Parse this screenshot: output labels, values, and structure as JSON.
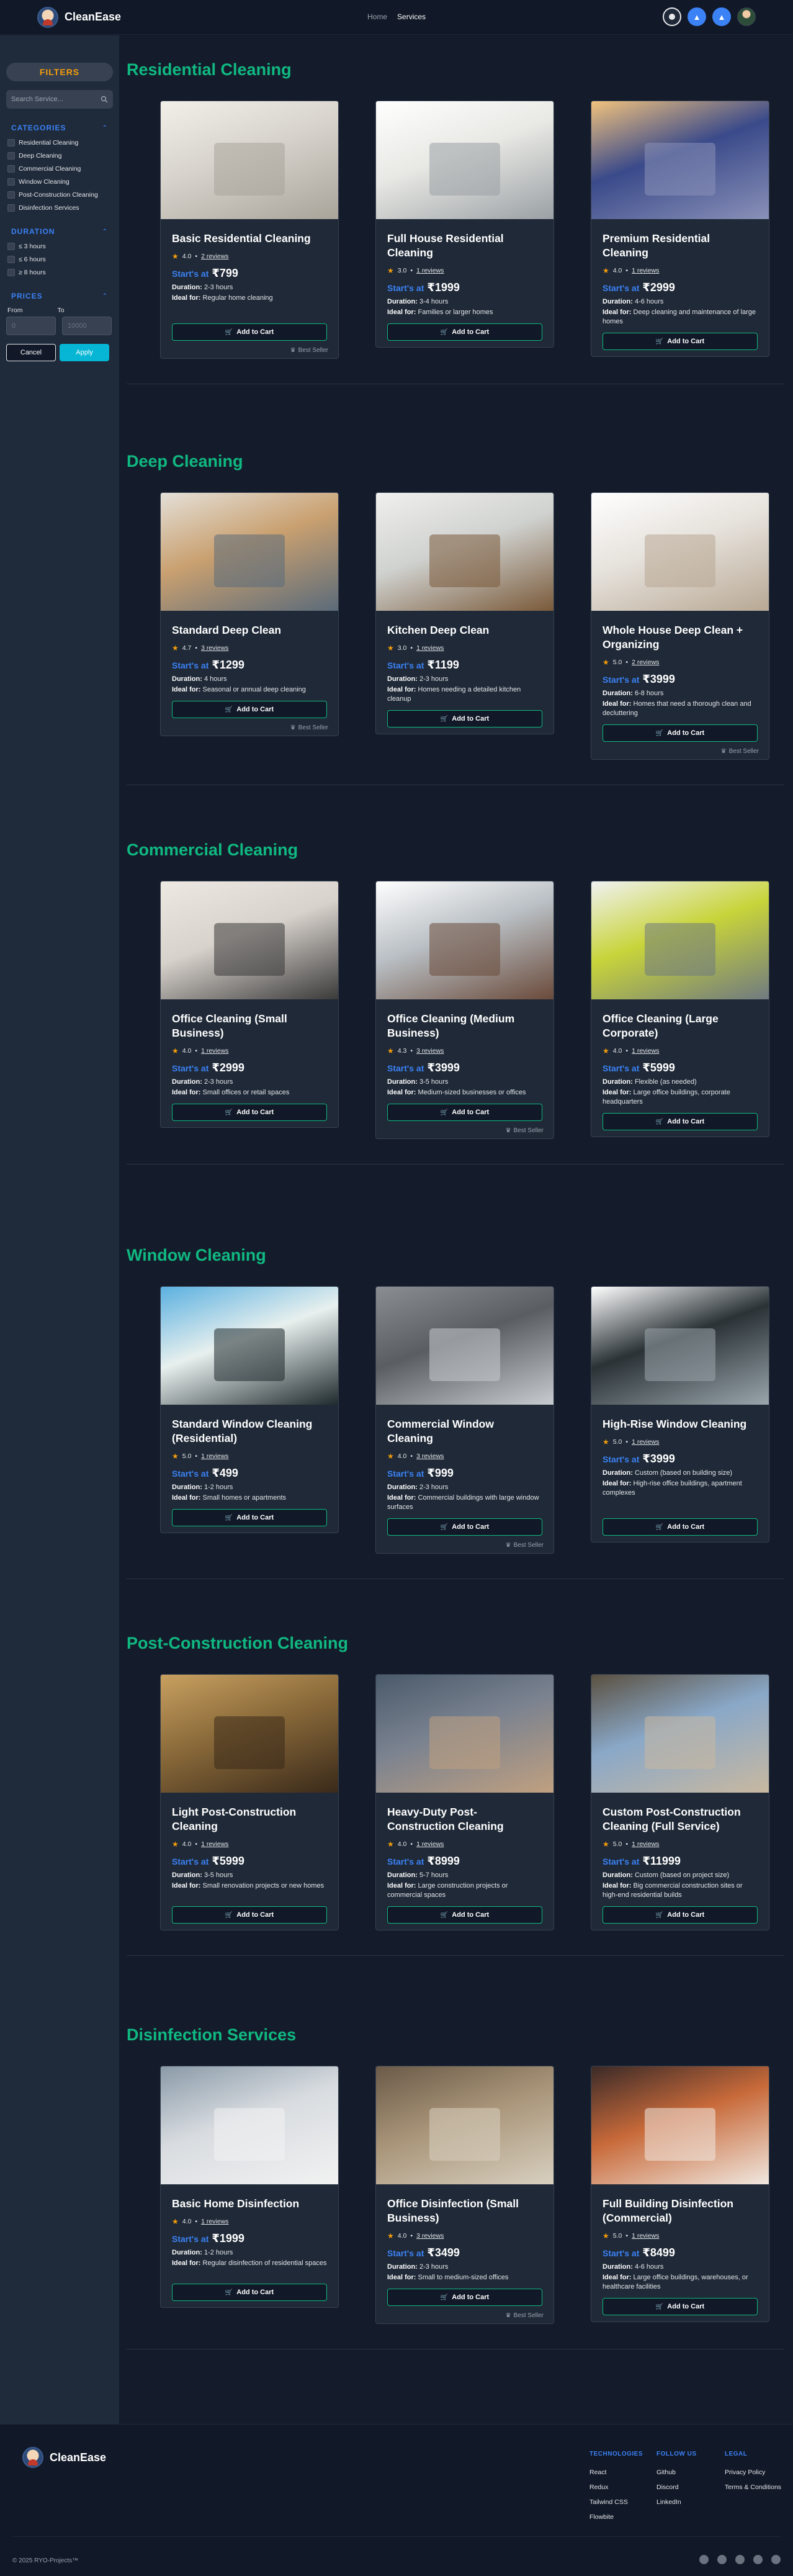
{
  "header": {
    "brand": "CleanEase",
    "nav": [
      {
        "label": "Home"
      },
      {
        "label": "Services"
      }
    ]
  },
  "sidebar": {
    "title": "FILTERS",
    "search_placeholder": "Search Service...",
    "categories": {
      "title": "CATEGORIES",
      "items": [
        "Residential Cleaning",
        "Deep Cleaning",
        "Commercial Cleaning",
        "Window Cleaning",
        "Post-Construction Cleaning",
        "Disinfection Services"
      ]
    },
    "duration": {
      "title": "DURATION",
      "items": [
        "≤ 3 hours",
        "≤ 6 hours",
        "≥ 8 hours"
      ]
    },
    "prices": {
      "title": "PRICES",
      "from_label": "From",
      "to_label": "To",
      "from_placeholder": "0",
      "to_placeholder": "10000"
    },
    "cancel_label": "Cancel",
    "apply_label": "Apply"
  },
  "common": {
    "starts_at": "Start's at",
    "duration_label": "Duration:",
    "ideal_label": "Ideal for:",
    "add_to_cart": "Add to Cart",
    "best_seller": "Best Seller"
  },
  "sections": [
    {
      "title": "Residential Cleaning",
      "cards": [
        {
          "name": "Basic Residential Cleaning",
          "rating": "4.0",
          "reviews": "2 reviews",
          "price": "₹799",
          "duration": "2-3 hours",
          "ideal": "Regular home cleaning",
          "best_seller": true
        },
        {
          "name": "Full House Residential Cleaning",
          "rating": "3.0",
          "reviews": "1 reviews",
          "price": "₹1999",
          "duration": "3-4 hours",
          "ideal": "Families or larger homes",
          "best_seller": false
        },
        {
          "name": "Premium Residential Cleaning",
          "rating": "4.0",
          "reviews": "1 reviews",
          "price": "₹2999",
          "duration": "4-6 hours",
          "ideal": "Deep cleaning and maintenance of large homes",
          "best_seller": false
        }
      ]
    },
    {
      "title": "Deep Cleaning",
      "cards": [
        {
          "name": "Standard Deep Clean",
          "rating": "4.7",
          "reviews": "3 reviews",
          "price": "₹1299",
          "duration": "4 hours",
          "ideal": "Seasonal or annual deep cleaning",
          "best_seller": true
        },
        {
          "name": "Kitchen Deep Clean",
          "rating": "3.0",
          "reviews": "1 reviews",
          "price": "₹1199",
          "duration": "2-3 hours",
          "ideal": "Homes needing a detailed kitchen cleanup",
          "best_seller": false
        },
        {
          "name": "Whole House Deep Clean + Organizing",
          "rating": "5.0",
          "reviews": "2 reviews",
          "price": "₹3999",
          "duration": "6-8 hours",
          "ideal": "Homes that need a thorough clean and decluttering",
          "best_seller": true
        }
      ]
    },
    {
      "title": "Commercial Cleaning",
      "cards": [
        {
          "name": "Office Cleaning (Small Business)",
          "rating": "4.0",
          "reviews": "1 reviews",
          "price": "₹2999",
          "duration": "2-3 hours",
          "ideal": "Small offices or retail spaces",
          "best_seller": false
        },
        {
          "name": "Office Cleaning (Medium Business)",
          "rating": "4.3",
          "reviews": "3 reviews",
          "price": "₹3999",
          "duration": "3-5 hours",
          "ideal": "Medium-sized businesses or offices",
          "best_seller": true
        },
        {
          "name": "Office Cleaning (Large Corporate)",
          "rating": "4.0",
          "reviews": "1 reviews",
          "price": "₹5999",
          "duration": "Flexible (as needed)",
          "ideal": "Large office buildings, corporate headquarters",
          "best_seller": false
        }
      ]
    },
    {
      "title": "Window Cleaning",
      "cards": [
        {
          "name": "Standard Window Cleaning (Residential)",
          "rating": "5.0",
          "reviews": "1 reviews",
          "price": "₹499",
          "duration": "1-2 hours",
          "ideal": "Small homes or apartments",
          "best_seller": false
        },
        {
          "name": "Commercial Window Cleaning",
          "rating": "4.0",
          "reviews": "3 reviews",
          "price": "₹999",
          "duration": "2-3 hours",
          "ideal": "Commercial buildings with large window surfaces",
          "best_seller": true
        },
        {
          "name": "High-Rise Window Cleaning",
          "rating": "5.0",
          "reviews": "1 reviews",
          "price": "₹3999",
          "duration": "Custom (based on building size)",
          "ideal": "High-rise office buildings, apartment complexes",
          "best_seller": false
        }
      ]
    },
    {
      "title": "Post-Construction Cleaning",
      "cards": [
        {
          "name": "Light Post-Construction Cleaning",
          "rating": "4.0",
          "reviews": "1 reviews",
          "price": "₹5999",
          "duration": "3-5 hours",
          "ideal": "Small renovation projects or new homes",
          "best_seller": false
        },
        {
          "name": "Heavy-Duty Post-Construction Cleaning",
          "rating": "4.0",
          "reviews": "1 reviews",
          "price": "₹8999",
          "duration": "5-7 hours",
          "ideal": "Large construction projects or commercial spaces",
          "best_seller": false
        },
        {
          "name": "Custom Post-Construction Cleaning (Full Service)",
          "rating": "5.0",
          "reviews": "1 reviews",
          "price": "₹11999",
          "duration": "Custom (based on project size)",
          "ideal": "Big commercial construction sites or high-end residential builds",
          "best_seller": false
        }
      ]
    },
    {
      "title": "Disinfection Services",
      "cards": [
        {
          "name": "Basic Home Disinfection",
          "rating": "4.0",
          "reviews": "1 reviews",
          "price": "₹1999",
          "duration": "1-2 hours",
          "ideal": "Regular disinfection of residential spaces",
          "best_seller": false
        },
        {
          "name": "Office Disinfection (Small Business)",
          "rating": "4.0",
          "reviews": "3 reviews",
          "price": "₹3499",
          "duration": "2-3 hours",
          "ideal": "Small to medium-sized offices",
          "best_seller": true
        },
        {
          "name": "Full Building Disinfection (Commercial)",
          "rating": "5.0",
          "reviews": "1 reviews",
          "price": "₹8499",
          "duration": "4-6 hours",
          "ideal": "Large office buildings, warehouses, or healthcare facilities",
          "best_seller": false
        }
      ]
    }
  ],
  "footer": {
    "brand": "CleanEase",
    "columns": [
      {
        "title": "TECHNOLOGIES",
        "links": [
          "React",
          "Redux",
          "Tailwind CSS",
          "Flowbite"
        ]
      },
      {
        "title": "FOLLOW US",
        "links": [
          "Github",
          "Discord",
          "LinkedIn"
        ]
      },
      {
        "title": "LEGAL",
        "links": [
          "Privacy Policy",
          "Terms & Conditions"
        ]
      }
    ],
    "copyright": "© 2025 RYO-Projects™"
  }
}
